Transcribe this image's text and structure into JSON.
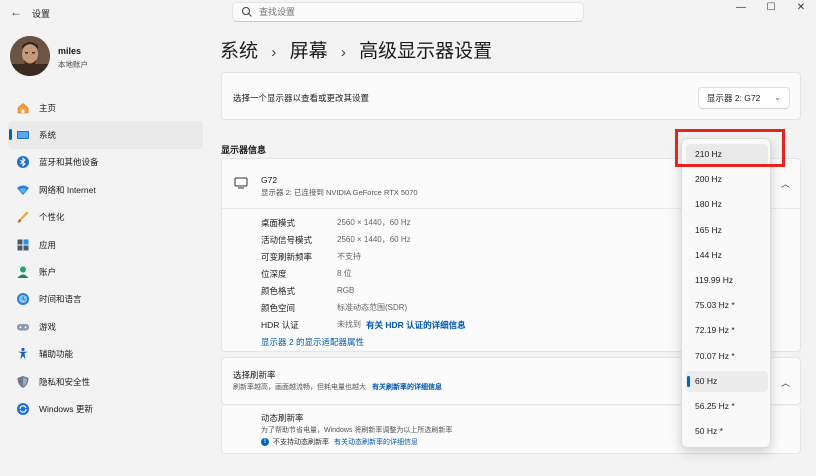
{
  "titlebar": {
    "back_icon": "back-arrow-icon",
    "app_title": "设置",
    "search_placeholder": "查找设置",
    "minimize": "—",
    "maximize": "☐",
    "close": "✕"
  },
  "profile": {
    "name": "miles",
    "account_type": "本地账户"
  },
  "sidebar": {
    "items": [
      {
        "label": "主页",
        "icon": "home-icon"
      },
      {
        "label": "系统",
        "icon": "system-icon",
        "active": true
      },
      {
        "label": "蓝牙和其他设备",
        "icon": "bluetooth-icon"
      },
      {
        "label": "网络和 Internet",
        "icon": "network-icon"
      },
      {
        "label": "个性化",
        "icon": "personalize-icon"
      },
      {
        "label": "应用",
        "icon": "apps-icon"
      },
      {
        "label": "账户",
        "icon": "account-icon"
      },
      {
        "label": "时间和语言",
        "icon": "time-language-icon"
      },
      {
        "label": "游戏",
        "icon": "gaming-icon"
      },
      {
        "label": "辅助功能",
        "icon": "accessibility-icon"
      },
      {
        "label": "隐私和安全性",
        "icon": "privacy-icon"
      },
      {
        "label": "Windows 更新",
        "icon": "windows-update-icon"
      }
    ]
  },
  "breadcrumb": {
    "part1": "系统",
    "part2": "屏幕",
    "part3": "高级显示器设置",
    "separator": "›"
  },
  "select_display": {
    "label": "选择一个显示器以查看或更改其设置",
    "value": "显示器 2: G72"
  },
  "display_info": {
    "section_title": "显示器信息",
    "monitor_name": "G72",
    "monitor_sub": "显示器 2: 已连接到 NVIDIA GeForce RTX 5070",
    "rows": [
      {
        "key": "桌面模式",
        "value": "2560 × 1440，60 Hz"
      },
      {
        "key": "活动信号模式",
        "value": "2560 × 1440，60 Hz"
      },
      {
        "key": "可变刷新频率",
        "value": "不支持"
      },
      {
        "key": "位深度",
        "value": "8 位"
      },
      {
        "key": "颜色格式",
        "value": "RGB"
      },
      {
        "key": "颜色空间",
        "value": "标准动态范围(SDR)"
      },
      {
        "key": "HDR 认证",
        "value": "未找到",
        "link": "有关 HDR 认证的详细信息"
      }
    ],
    "adapter_link": "显示器 2 的显示适配器属性"
  },
  "refresh_rate": {
    "title": "选择刷新率",
    "subtitle": "刷新率越高，画面越流畅，但耗电量也越大",
    "subtitle_link": "有关刷新率的详细信息"
  },
  "dynamic_rate": {
    "title": "动态刷新率",
    "subtitle": "为了帮助节省电量，Windows 将刷新率调整为以上所选刷新率",
    "warning": "不支持动态刷新率",
    "warning_link": "有关动态刷新率的详细信息"
  },
  "rate_options": [
    {
      "label": "210 Hz",
      "state": "hover"
    },
    {
      "label": "200 Hz"
    },
    {
      "label": "180 Hz"
    },
    {
      "label": "165 Hz"
    },
    {
      "label": "144 Hz"
    },
    {
      "label": "119.99 Hz"
    },
    {
      "label": "75.03 Hz *"
    },
    {
      "label": "72.19 Hz *"
    },
    {
      "label": "70.07 Hz *"
    },
    {
      "label": "60 Hz",
      "state": "selected"
    },
    {
      "label": "56.25 Hz *"
    },
    {
      "label": "50 Hz *"
    }
  ],
  "colors": {
    "accent": "#0067c0",
    "highlight": "#e8231c",
    "link": "#0058b3"
  }
}
